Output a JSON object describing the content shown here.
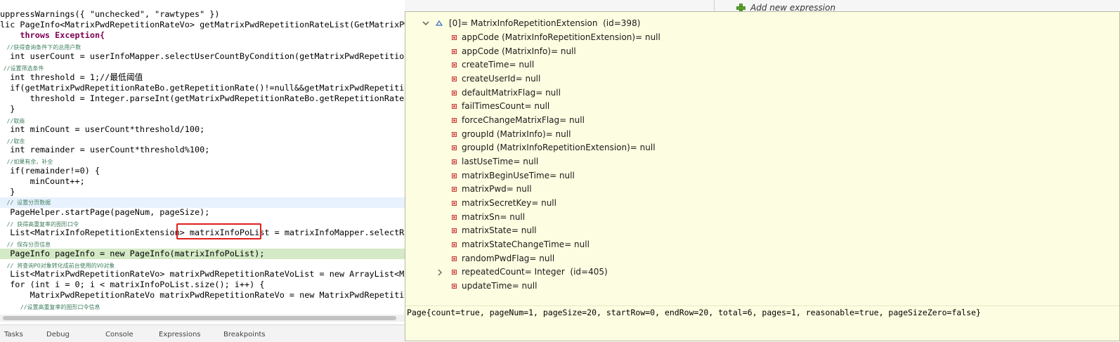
{
  "editor": {
    "lines": [
      "uppressWarnings({ \"unchecked\", \"rawtypes\" })",
      "lic PageInfo<MatrixPwdRepetitionRateVo> getMatrixPwdRepetitionRateList(GetMatrixPwd",
      "    throws Exception{",
      "  //获得查询条件下的总用户数",
      "  int userCount = userInfoMapper.selectUserCountByCondition(getMatrixPwdRepetitionRat",
      " //设置筛选条件",
      "  int threshold = 1;//最低阈值",
      "  if(getMatrixPwdRepetitionRateBo.getRepetitionRate()!=null&&getMatrixPwdRepetitionRa",
      "      threshold = Integer.parseInt(getMatrixPwdRepetitionRateBo.getRepetitionRate())",
      "  }",
      "  //取商",
      "  int minCount = userCount*threshold/100;",
      "  //取余",
      "  int remainder = userCount*threshold%100;",
      "  //如果有余，补全",
      "  if(remainder!=0) {",
      "      minCount++;",
      "  }",
      "  // 设置分页数据",
      "  PageHelper.startPage(pageNum, pageSize);",
      "  // 获得高重复率的图形口令",
      "  List<MatrixInfoRepetitionExtension> matrixInfoPoList = matrixInfoMapper.selectRepea",
      "  // 保存分页信息",
      "  PageInfo pageInfo = new PageInfo(matrixInfoPoList);",
      "  // 将查询PO对象转化成前台使用的VO对象",
      "  List<MatrixPwdRepetitionRateVo> matrixPwdRepetitionRateVoList = new ArrayList<Matr",
      "  for (int i = 0; i < matrixInfoPoList.size(); i++) {",
      "      MatrixPwdRepetitionRateVo matrixPwdRepetitionRateVo = new MatrixPwdRepetitionRa",
      "      //设置高重复率的图形口令信息"
    ],
    "highlighted_variable": "matrixInfoPoList",
    "bottom_tabs": [
      "Tasks",
      "Debug",
      "Console",
      "Expressions",
      "Breakpoints"
    ]
  },
  "expressions_view": {
    "add_new_expression": "Add new expression"
  },
  "popup": {
    "root_label": "[0]= MatrixInfoRepetitionExtension  (id=398)",
    "fields": [
      "appCode (MatrixInfoRepetitionExtension)= null",
      "appCode (MatrixInfo)= null",
      "createTime= null",
      "createUserId= null",
      "defaultMatrixFlag= null",
      "failTimesCount= null",
      "forceChangeMatrixFlag= null",
      "groupId (MatrixInfo)= null",
      "groupId (MatrixInfoRepetitionExtension)= null",
      "lastUseTime= null",
      "matrixBeginUseTime= null",
      "matrixPwd= null",
      "matrixSecretKey= null",
      "matrixSn= null",
      "matrixState= null",
      "matrixStateChangeTime= null",
      "randomPwdFlag= null",
      "repeatedCount= Integer  (id=405)",
      "updateTime= null"
    ],
    "expandable_field": "repeatedCount= Integer  (id=405)",
    "detail_text": "Page{count=true, pageNum=1, pageSize=20, startRow=0, endRow=20, total=6, pages=1, reasonable=true, pageSizeZero=false}"
  },
  "colors": {
    "editor_keyword": "#7f0055",
    "editor_string": "#2a00ff",
    "editor_field": "#0000c0",
    "editor_comment": "#3f7f5f",
    "popup_background": "#fdfde1",
    "highlight_box": "#e0201c"
  },
  "icons": {
    "field": "private-field-icon",
    "expand": "chevron-down-icon",
    "collapsed": "chevron-right-icon",
    "add": "plus-icon"
  }
}
